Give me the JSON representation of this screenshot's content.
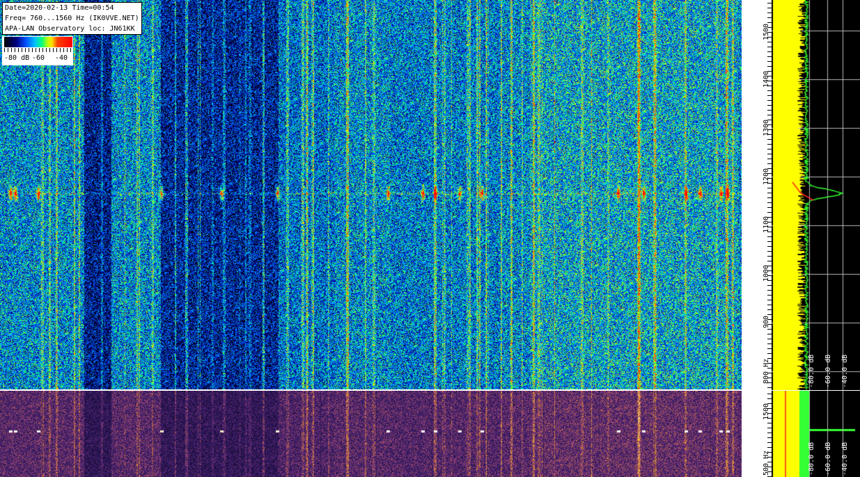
{
  "info": {
    "line1": "Date=2020-02-13 Time=00:54",
    "line2": "Freq= 760...1560 Hz (IK0VVE.NET)",
    "line3": "APA-LAN Observatory loc: JN61KK"
  },
  "colorbar": {
    "label_low": "-80 dB",
    "label_mid": "-60",
    "label_high": "-40",
    "colors": [
      "#000000",
      "#000080",
      "#0050ff",
      "#00c0ff",
      "#00ff80",
      "#c0ff00",
      "#ffe000",
      "#ff0000"
    ]
  },
  "freq_axis_main": {
    "labels": [
      "1500",
      "1400",
      "1300",
      "1200",
      "1100",
      "1000",
      "900",
      "800 Hz"
    ]
  },
  "freq_axis_bottom": {
    "labels": [
      "1500",
      "500 Hz"
    ]
  },
  "spectrum_db_labels_main": [
    "-80.0 dB",
    "-60.0 dB",
    "-40.0 dB"
  ],
  "spectrum_db_labels_bottom": [
    "-80.0 dB",
    "-60.0 dB",
    "-40.0 dB"
  ],
  "signal_frequency_hz": 1160,
  "colors": {
    "spectrum_avg": "#ffff00",
    "spectrum_peak": "#33ff33",
    "spectrum_ref": "#ff2020",
    "bottom_palette_base": "#2a1060",
    "bottom_palette_hot": "#ffb000"
  }
}
